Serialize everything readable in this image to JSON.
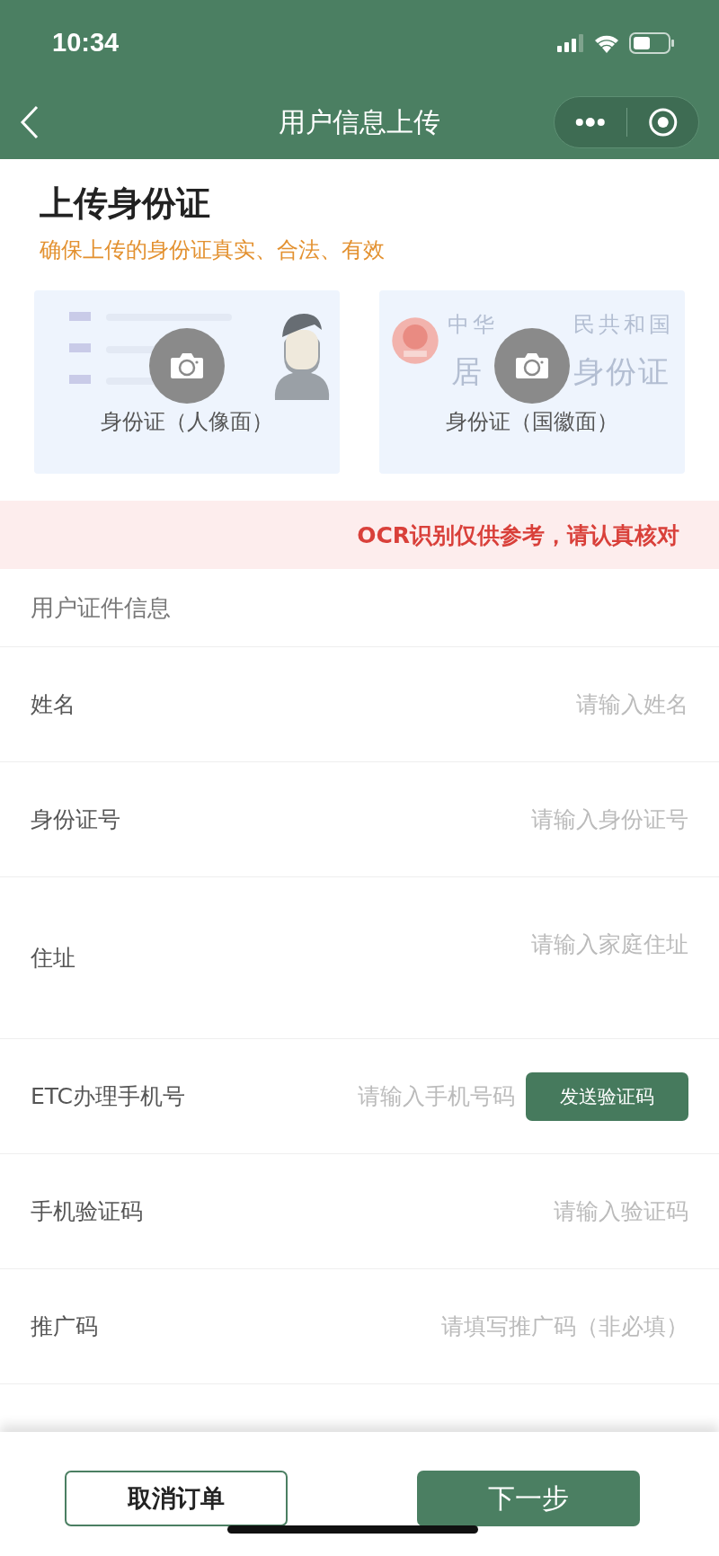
{
  "status_bar": {
    "time": "10:34"
  },
  "nav": {
    "title": "用户信息上传"
  },
  "upload": {
    "title": "上传身份证",
    "subtitle": "确保上传的身份证真实、合法、有效",
    "cards": [
      {
        "kind": "portrait",
        "label": "身份证（人像面）"
      },
      {
        "kind": "emblem",
        "label": "身份证（国徽面）",
        "art_texts": [
          "中华",
          "民共和国",
          "居",
          "身份证"
        ]
      }
    ]
  },
  "notice": "OCR识别仅供参考，请认真核对",
  "form": {
    "title": "用户证件信息",
    "fields": [
      {
        "kind": "text",
        "label": "姓名",
        "placeholder": "请输入姓名"
      },
      {
        "kind": "text",
        "label": "身份证号",
        "placeholder": "请输入身份证号"
      },
      {
        "kind": "textarea",
        "label": "住址",
        "placeholder": "请输入家庭住址"
      },
      {
        "kind": "phone",
        "label": "ETC办理手机号",
        "placeholder": "请输入手机号码",
        "button": "发送验证码"
      },
      {
        "kind": "text",
        "label": "手机验证码",
        "placeholder": "请输入验证码"
      },
      {
        "kind": "text",
        "label": "推广码",
        "placeholder": "请填写推广码（非必填）"
      }
    ]
  },
  "buttons": {
    "cancel": "取消订单",
    "next": "下一步"
  }
}
